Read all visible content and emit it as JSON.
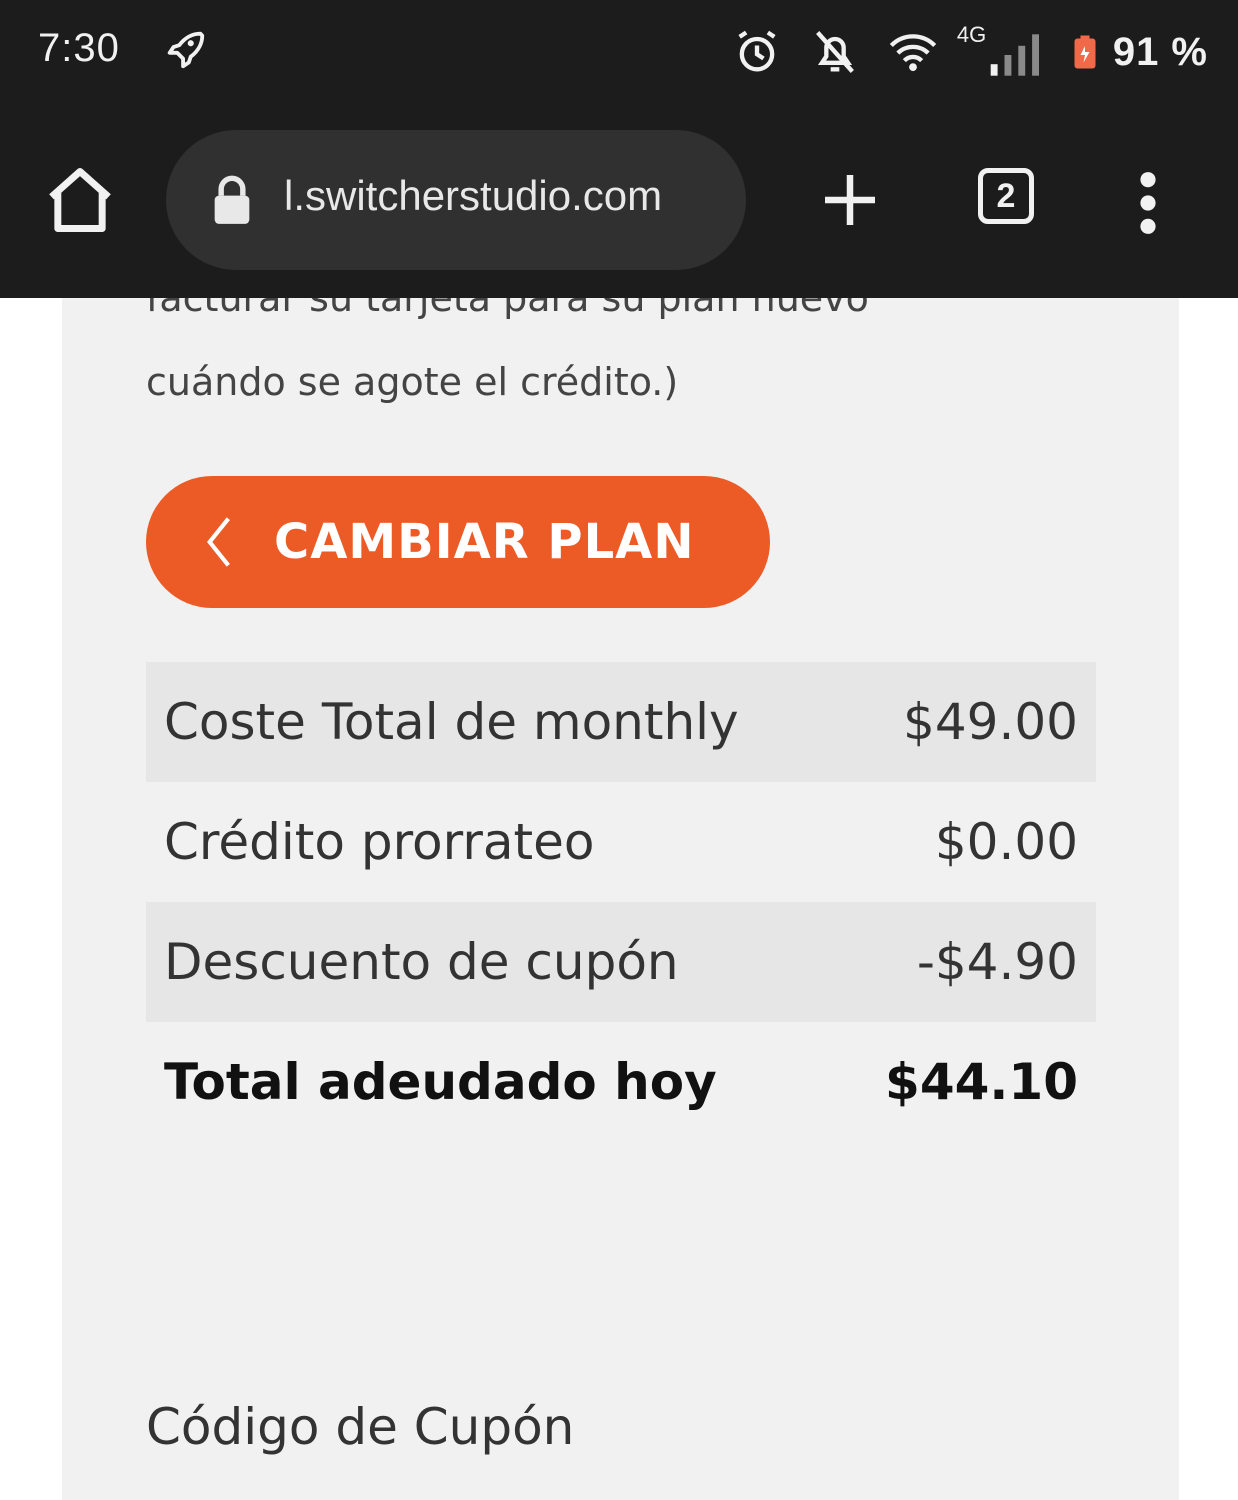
{
  "status_bar": {
    "time": "7:30",
    "icons": [
      "rocket-icon",
      "alarm-icon",
      "notifications-off-icon",
      "wifi-icon",
      "cellular-signal-icon",
      "battery-icon"
    ],
    "network_label": "4G",
    "battery_percent": "91 %"
  },
  "browser": {
    "url": "l.switcherstudio.com",
    "tab_count": "2"
  },
  "page": {
    "cut_text": "facturar su tarjeta para su plan nuevo",
    "note_text": "cuándo se agote el crédito.)",
    "change_plan_label": "CAMBIAR PLAN",
    "summary_rows": [
      {
        "label": "Coste Total de monthly",
        "value": "$49.00"
      },
      {
        "label": "Crédito prorrateo",
        "value": "$0.00"
      },
      {
        "label": "Descuento de cupón",
        "value": "-$4.90"
      },
      {
        "label": "Total adeudado hoy",
        "value": "$44.10"
      }
    ],
    "coupon_heading": "Código de Cupón"
  },
  "colors": {
    "accent": "#ec5a25",
    "chrome_bg": "#1c1c1c",
    "page_bg": "#f1f1f1",
    "row_shade": "#e6e6e6"
  }
}
